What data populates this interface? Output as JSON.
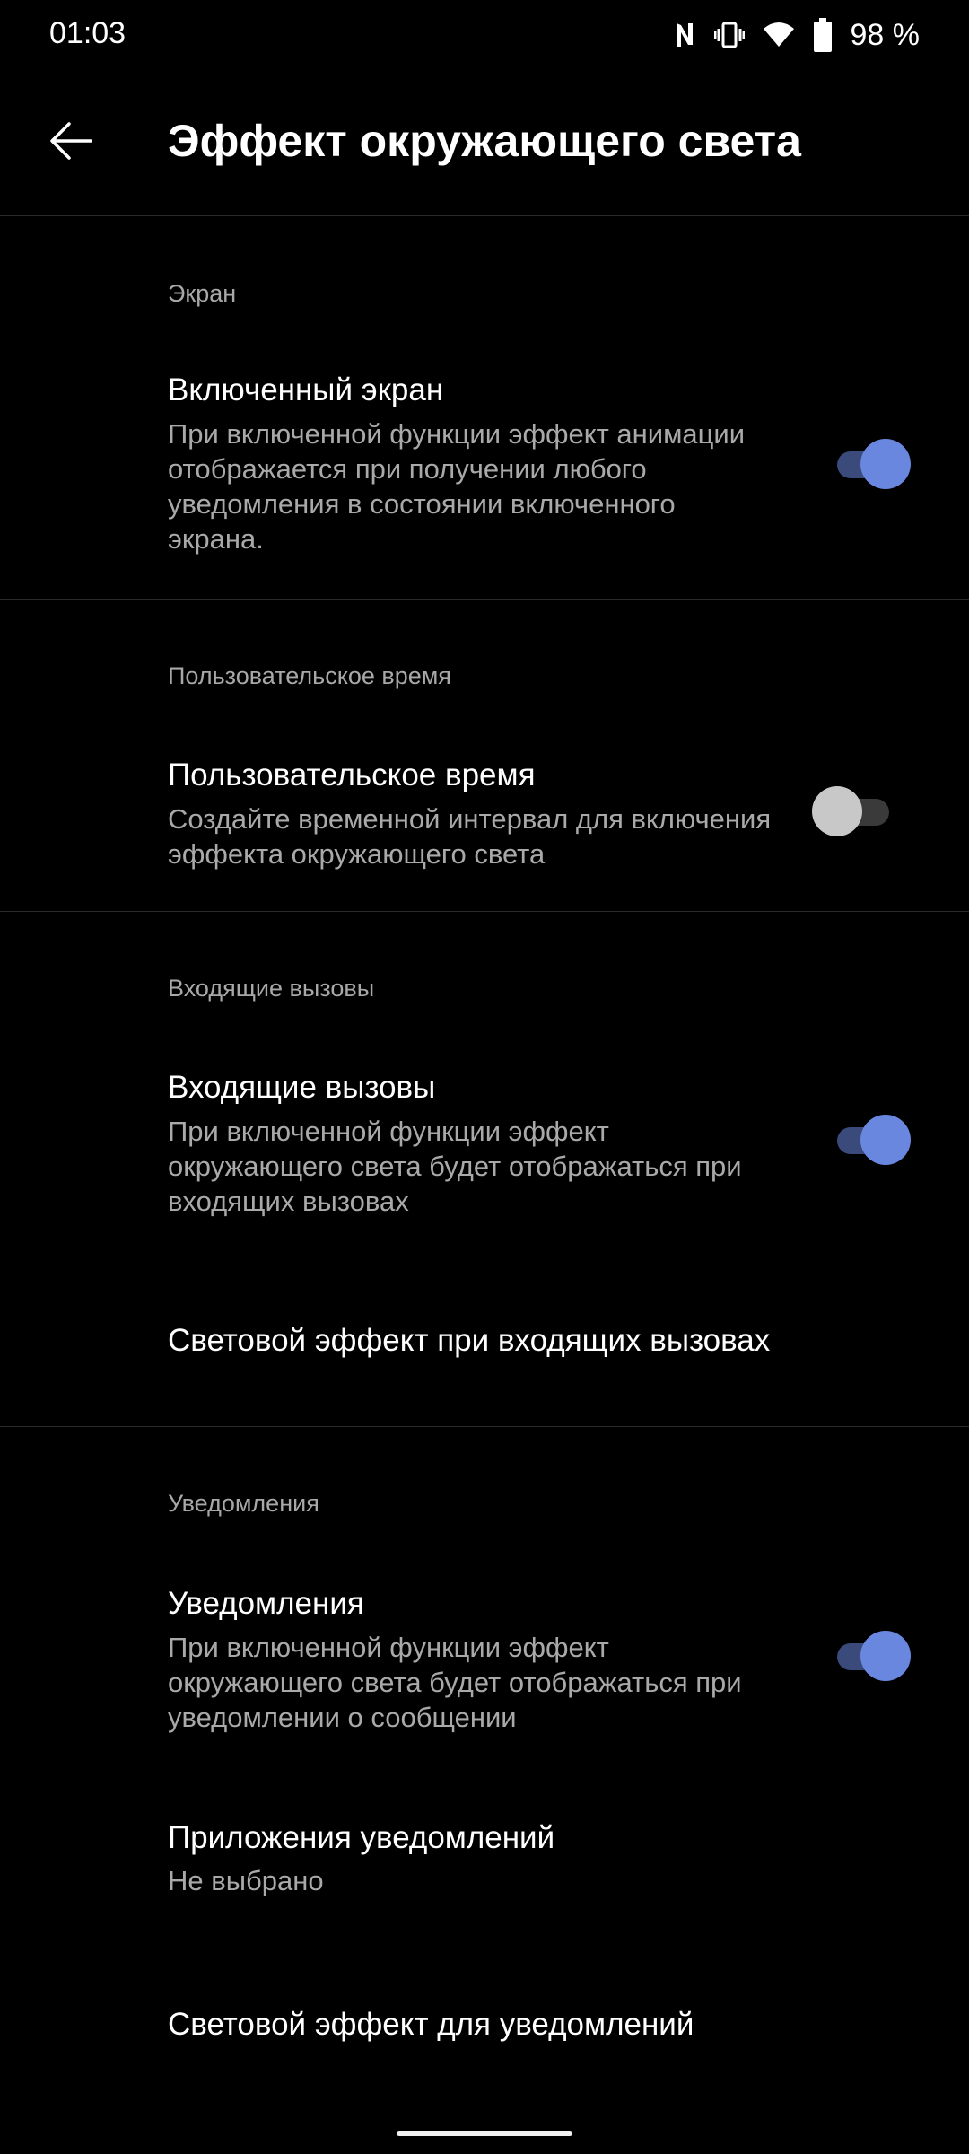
{
  "status_bar": {
    "time": "01:03",
    "battery": "98 %",
    "icons": [
      "nfc-icon",
      "vibrate-icon",
      "wifi-icon",
      "battery-icon"
    ]
  },
  "header": {
    "title": "Эффект окружающего света",
    "back_icon": "arrow-left-icon"
  },
  "sections": {
    "screen": {
      "header": "Экран",
      "item": {
        "title": "Включенный экран",
        "description": "При включенной функции эффект анимации отображается при получении любого уведомления в состоянии включенного экрана.",
        "enabled": true
      }
    },
    "custom_time": {
      "header": "Пользовательское время",
      "item": {
        "title": "Пользовательское время",
        "description": "Создайте временной интервал для включения эффекта окружающего света",
        "enabled": false
      }
    },
    "incoming_calls": {
      "header": "Входящие вызовы",
      "item": {
        "title": "Входящие вызовы",
        "description": "При включенной функции эффект окружающего света будет отображаться при входящих вызовах",
        "enabled": true
      },
      "light_effect_label": "Световой эффект при входящих вызовах"
    },
    "notifications": {
      "header": "Уведомления",
      "item": {
        "title": "Уведомления",
        "description": "При включенной функции эффект окружающего света будет отображаться при уведомлении о сообщении",
        "enabled": true
      },
      "apps": {
        "title": "Приложения уведомлений",
        "value": "Не выбрано"
      },
      "light_effect_label": "Световой эффект для уведомлений"
    }
  },
  "colors": {
    "background": "#000000",
    "accent": "#6a87e0",
    "accent_track": "#3a4a7a",
    "secondary_text": "#a9a9a9"
  }
}
